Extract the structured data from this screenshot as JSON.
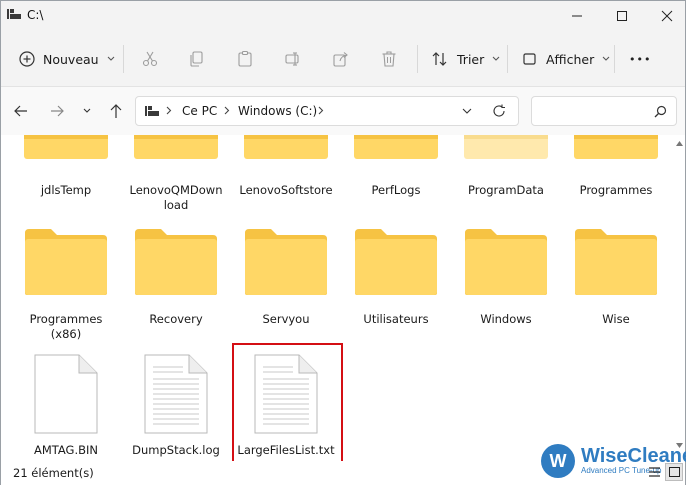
{
  "window": {
    "title": "C:\\"
  },
  "toolbar": {
    "new_label": "Nouveau",
    "sort_label": "Trier",
    "view_label": "Afficher",
    "more_label": "•••"
  },
  "address": {
    "crumbs": [
      "Ce PC",
      "Windows (C:)"
    ]
  },
  "search": {
    "placeholder": ""
  },
  "rows": {
    "row1": [
      "jdlsTemp",
      "LenovoQMDown\nload",
      "LenovoSoftstore",
      "PerfLogs",
      "ProgramData",
      "Programmes"
    ],
    "row2": [
      "Programmes\n(x86)",
      "Recovery",
      "Servyou",
      "Utilisateurs",
      "Windows",
      "Wise"
    ],
    "row3": [
      "AMTAG.BIN",
      "DumpStack.log",
      "LargeFilesList.txt"
    ]
  },
  "status": {
    "count": "21 élément(s)"
  },
  "watermark": {
    "brand": "WiseCleaner",
    "tagline": "Advanced PC Tune-up",
    "logo_letter": "W"
  },
  "colors": {
    "folder": "#ffd766",
    "folder_back": "#f6c343",
    "highlight": "#d40f14",
    "accent": "#2f7cc1"
  }
}
